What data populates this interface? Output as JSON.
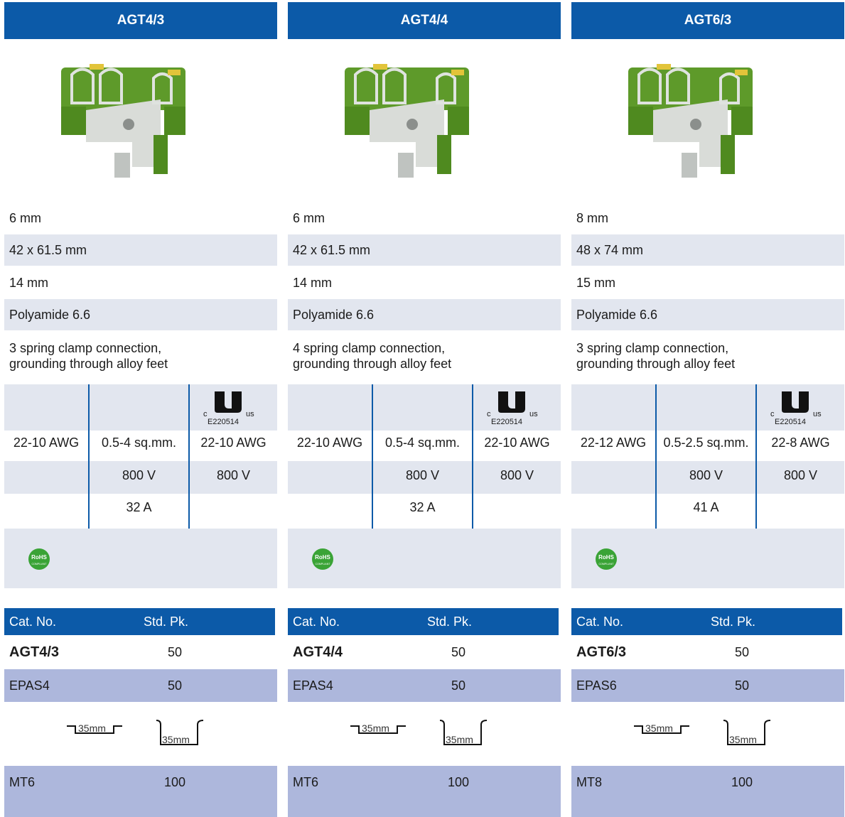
{
  "columns": [
    {
      "model": "AGT4/3",
      "width": "6 mm",
      "dimensions": "42 x 61.5 mm",
      "depth": "14 mm",
      "material": "Polyamide 6.6",
      "connection_line1": "3 spring clamp connection,",
      "connection_line2": "grounding through alloy feet",
      "ul_c": "c",
      "ul_us": "us",
      "ul_file": "E220514",
      "wire_awg": "22-10 AWG",
      "wire_sqmm": "0.5-4 sq.mm.",
      "wire_ul": "22-10 AWG",
      "voltage_iec": "800 V",
      "voltage_ul": "800 V",
      "current_iec": "32 A",
      "rohs_text": "RoHS",
      "rohs_sub": "COMPLIANT",
      "cat_header": "Cat. No.",
      "pk_header": "Std. Pk.",
      "cat_no": "AGT4/3",
      "cat_pk": "50",
      "accessory": "EPAS4",
      "accessory_pk": "50",
      "rail_label_1": "35mm",
      "rail_label_2": "35mm",
      "marker": "MT6",
      "marker_pk": "100"
    },
    {
      "model": "AGT4/4",
      "width": "6 mm",
      "dimensions": "42 x 61.5 mm",
      "depth": "14 mm",
      "material": "Polyamide 6.6",
      "connection_line1": "4 spring clamp connection,",
      "connection_line2": "grounding through alloy feet",
      "ul_c": "c",
      "ul_us": "us",
      "ul_file": "E220514",
      "wire_awg": "22-10 AWG",
      "wire_sqmm": "0.5-4 sq.mm.",
      "wire_ul": "22-10 AWG",
      "voltage_iec": "800 V",
      "voltage_ul": "800 V",
      "current_iec": "32 A",
      "rohs_text": "RoHS",
      "rohs_sub": "COMPLIANT",
      "cat_header": "Cat. No.",
      "pk_header": "Std. Pk.",
      "cat_no": "AGT4/4",
      "cat_pk": "50",
      "accessory": "EPAS4",
      "accessory_pk": "50",
      "rail_label_1": "35mm",
      "rail_label_2": "35mm",
      "marker": "MT6",
      "marker_pk": "100"
    },
    {
      "model": "AGT6/3",
      "width": "8 mm",
      "dimensions": "48 x 74 mm",
      "depth": "15 mm",
      "material": "Polyamide 6.6",
      "connection_line1": "3 spring clamp connection,",
      "connection_line2": "grounding through alloy feet",
      "ul_c": "c",
      "ul_us": "us",
      "ul_file": "E220514",
      "wire_awg": "22-12 AWG",
      "wire_sqmm": "0.5-2.5 sq.mm.",
      "wire_ul": "22-8 AWG",
      "voltage_iec": "800 V",
      "voltage_ul": "800 V",
      "current_iec": "41 A",
      "rohs_text": "RoHS",
      "rohs_sub": "COMPLIANT",
      "cat_header": "Cat. No.",
      "pk_header": "Std. Pk.",
      "cat_no": "AGT6/3",
      "cat_pk": "50",
      "accessory": "EPAS6",
      "accessory_pk": "50",
      "rail_label_1": "35mm",
      "rail_label_2": "35mm",
      "marker": "MT8",
      "marker_pk": "100"
    }
  ],
  "colors": {
    "header_blue": "#0c5aa8",
    "row_shade": "#e2e6ef",
    "order_shade": "#adb7dc",
    "terminal_green": "#4f8a1f",
    "rohs_green": "#3aa336"
  },
  "icons": [
    "terminal-block-photo",
    "ul-recognized-mark",
    "rohs-compliant-badge",
    "din-rail-top-hat-icon",
    "din-rail-g-profile-icon"
  ]
}
